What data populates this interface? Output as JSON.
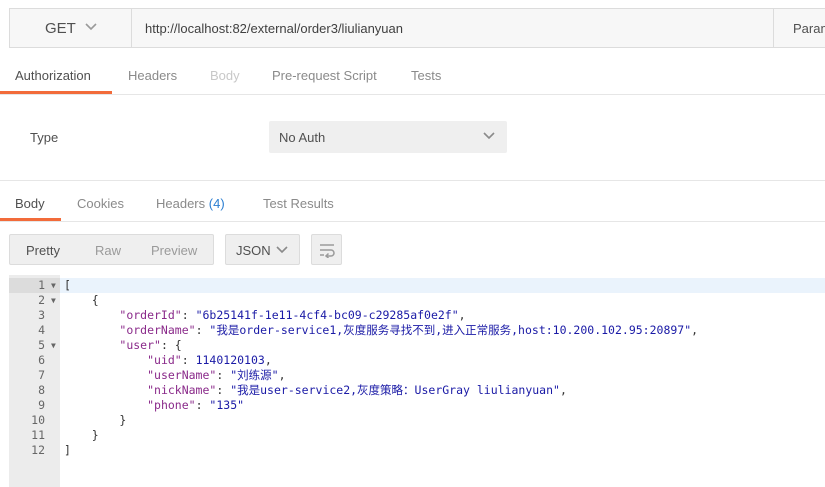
{
  "request": {
    "method": "GET",
    "url": "http://localhost:82/external/order3/liulianyuan",
    "params_label": "Param"
  },
  "request_tabs": [
    {
      "label": "Authorization",
      "state": "active"
    },
    {
      "label": "Headers",
      "state": "normal"
    },
    {
      "label": "Body",
      "state": "disabled"
    },
    {
      "label": "Pre-request Script",
      "state": "normal"
    },
    {
      "label": "Tests",
      "state": "normal"
    }
  ],
  "auth": {
    "type_label": "Type",
    "type_value": "No Auth"
  },
  "response_tabs": {
    "body": "Body",
    "cookies": "Cookies",
    "headers": "Headers",
    "headers_count": "(4)",
    "test_results": "Test Results"
  },
  "view_modes": {
    "pretty": "Pretty",
    "raw": "Raw",
    "preview": "Preview"
  },
  "format": "JSON",
  "icons": {
    "method_chevron": "chevron-down-icon",
    "auth_chevron": "chevron-down-icon",
    "format_chevron": "chevron-down-icon",
    "wrap": "wrap-lines-icon"
  },
  "colors": {
    "accent": "#f26b3a",
    "count": "#2b7ed1"
  },
  "code": {
    "lines": [
      {
        "n": "1",
        "fold": true,
        "text": "["
      },
      {
        "n": "2",
        "fold": true,
        "text": "    {"
      },
      {
        "n": "3",
        "fold": false,
        "key": "\"orderId\"",
        "sep": ": ",
        "val": "\"6b25141f-1e11-4cf4-bc09-c29285af0e2f\"",
        "tail": ",",
        "indent": "        "
      },
      {
        "n": "4",
        "fold": false,
        "key": "\"orderName\"",
        "sep": ": ",
        "val": "\"我是order-service1,灰度服务寻找不到,进入正常服务,host:10.200.102.95:20897\"",
        "tail": ",",
        "indent": "        "
      },
      {
        "n": "5",
        "fold": true,
        "key": "\"user\"",
        "sep": ": ",
        "val": "",
        "tail": "{",
        "indent": "        "
      },
      {
        "n": "6",
        "fold": false,
        "key": "\"uid\"",
        "sep": ": ",
        "val": "1140120103",
        "tail": ",",
        "indent": "            "
      },
      {
        "n": "7",
        "fold": false,
        "key": "\"userName\"",
        "sep": ": ",
        "val": "\"刘练源\"",
        "tail": ",",
        "indent": "            "
      },
      {
        "n": "8",
        "fold": false,
        "key": "\"nickName\"",
        "sep": ": ",
        "val": "\"我是user-service2,灰度策略：UserGray liulianyuan\"",
        "tail": ",",
        "indent": "            "
      },
      {
        "n": "9",
        "fold": false,
        "key": "\"phone\"",
        "sep": ": ",
        "val": "\"135\"",
        "tail": "",
        "indent": "            "
      },
      {
        "n": "10",
        "fold": false,
        "text": "        }"
      },
      {
        "n": "11",
        "fold": false,
        "text": "    }"
      },
      {
        "n": "12",
        "fold": false,
        "text": "]"
      }
    ]
  }
}
